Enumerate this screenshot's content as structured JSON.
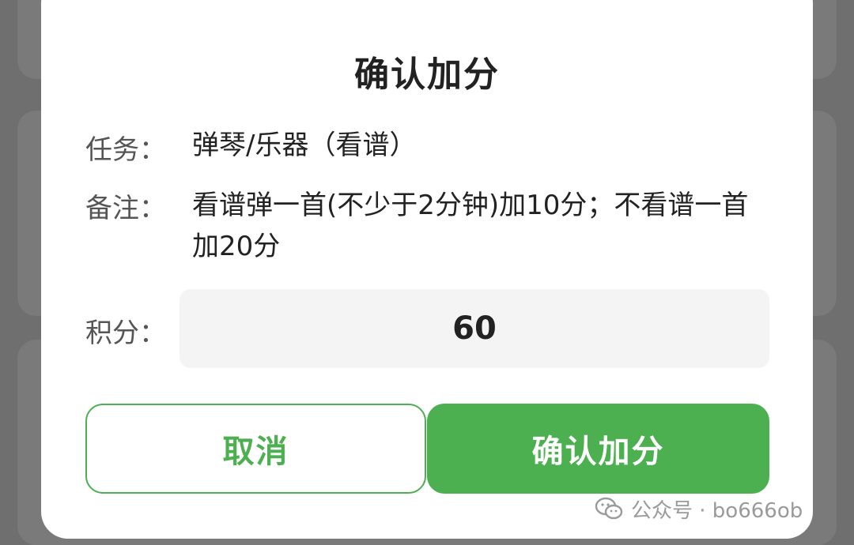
{
  "dialog": {
    "title": "确认加分",
    "task_label": "任务：",
    "task_value": "弹琴/乐器（看谱）",
    "note_label": "备注：",
    "note_value": "看谱弹一首(不少于2分钟)加10分；不看谱一首加20分",
    "score_label": "积分：",
    "score_value": "60",
    "cancel_label": "取消",
    "confirm_label": "确认加分"
  },
  "watermark": {
    "text": "公众号 · bo666ob",
    "icon": "wechat-icon"
  },
  "colors": {
    "accent": "#4caf50",
    "overlay": "#6f6f6f",
    "input_bg": "#f4f4f4"
  }
}
